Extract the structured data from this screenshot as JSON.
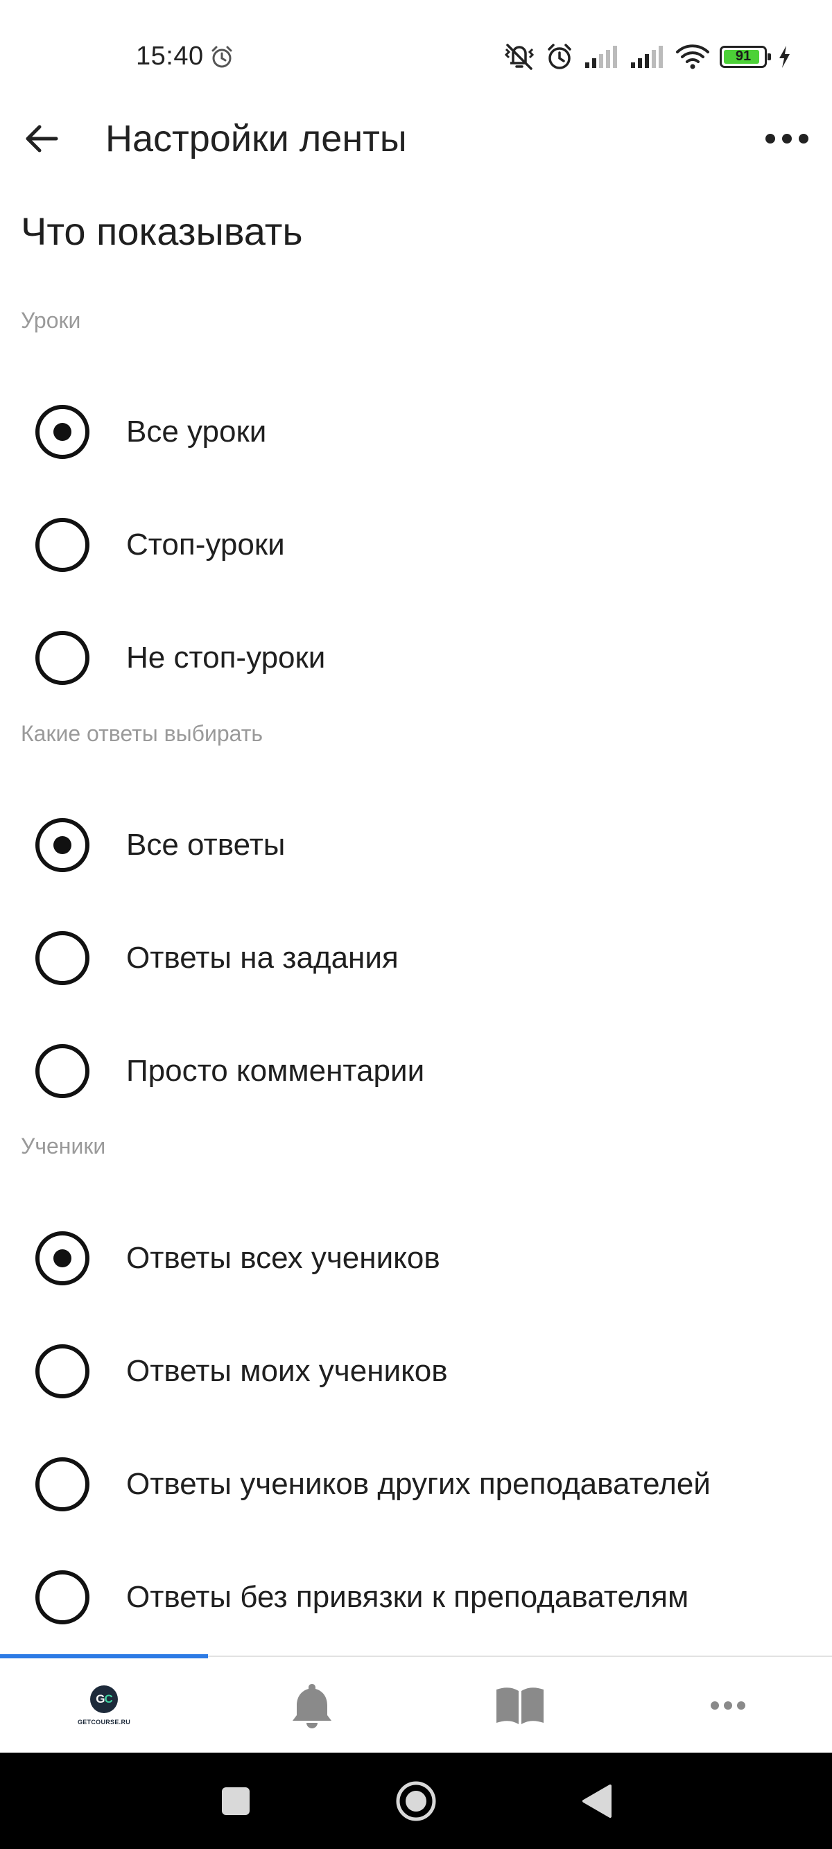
{
  "status_bar": {
    "time": "15:40",
    "battery_level": 91,
    "battery_text": "91",
    "icons": [
      "alarm-icon",
      "mute-vibrate-icon",
      "alarm-icon",
      "signal-icon",
      "signal-icon",
      "wifi-icon",
      "battery-icon",
      "charging-icon"
    ]
  },
  "app_bar": {
    "title": "Настройки ленты",
    "back_icon": "arrow-left-icon",
    "more_icon": "more-horizontal-icon"
  },
  "content": {
    "heading": "Что показывать",
    "groups": [
      {
        "label": "Уроки",
        "options": [
          {
            "label": "Все уроки",
            "selected": true
          },
          {
            "label": "Стоп-уроки",
            "selected": false
          },
          {
            "label": "Не стоп-уроки",
            "selected": false
          }
        ]
      },
      {
        "label": "Какие ответы выбирать",
        "options": [
          {
            "label": "Все ответы",
            "selected": true
          },
          {
            "label": "Ответы на задания",
            "selected": false
          },
          {
            "label": "Просто комментарии",
            "selected": false
          }
        ]
      },
      {
        "label": "Ученики",
        "options": [
          {
            "label": "Ответы всех учеников",
            "selected": true
          },
          {
            "label": "Ответы моих учеников",
            "selected": false
          },
          {
            "label": "Ответы учеников других преподавателей",
            "selected": false
          },
          {
            "label": "Ответы без привязки к преподавателям",
            "selected": false
          }
        ]
      }
    ]
  },
  "bottom_nav": {
    "items": [
      {
        "name": "getcourse-home",
        "logo_text": "GC",
        "caption": "GETCOURSE.RU",
        "active": true
      },
      {
        "name": "notifications",
        "icon": "bell-icon",
        "active": false
      },
      {
        "name": "training",
        "icon": "book-icon",
        "active": false
      },
      {
        "name": "more",
        "icon": "more-horizontal-icon",
        "active": false
      }
    ],
    "active_color": "#2d7be5",
    "icon_color": "#8a8a8a"
  },
  "system_nav": {
    "buttons": [
      "recents-square-icon",
      "home-circle-icon",
      "back-triangle-icon"
    ]
  }
}
